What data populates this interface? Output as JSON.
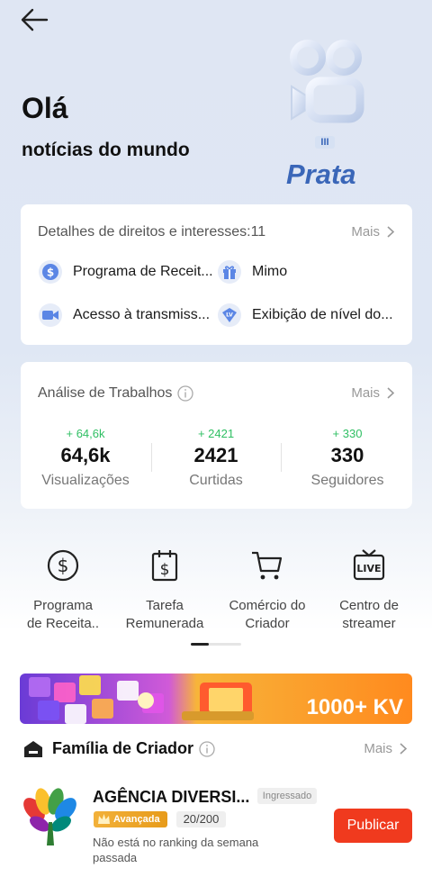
{
  "header": {
    "greeting": "Olá",
    "subtitle": "notícias do mundo",
    "badge_level": "Prata",
    "badge_numeral": "III"
  },
  "rights": {
    "title": "Detalhes de direitos e interesses:11",
    "more": "Mais",
    "items": [
      {
        "label": "Programa de Receit...",
        "icon": "dollar-icon"
      },
      {
        "label": "Mimo",
        "icon": "gift-icon"
      },
      {
        "label": "Acesso à transmiss...",
        "icon": "video-icon"
      },
      {
        "label": "Exibição de nível do...",
        "icon": "level-icon"
      }
    ]
  },
  "analysis": {
    "title": "Análise de Trabalhos",
    "more": "Mais",
    "stats": [
      {
        "delta": "+ 64,6k",
        "value": "64,6k",
        "label": "Visualizações"
      },
      {
        "delta": "+ 2421",
        "value": "2421",
        "label": "Curtidas"
      },
      {
        "delta": "+ 330",
        "value": "330",
        "label": "Seguidores"
      }
    ]
  },
  "tools": [
    {
      "line1": "Programa",
      "line2": "de Receita..",
      "icon": "dollar-circle-icon"
    },
    {
      "line1": "Tarefa",
      "line2": "Remunerada",
      "icon": "calendar-dollar-icon"
    },
    {
      "line1": "Comércio do",
      "line2": "Criador",
      "icon": "cart-icon"
    },
    {
      "line1": "Centro de",
      "line2": "streamer",
      "icon": "live-tv-icon"
    }
  ],
  "banner": {
    "text": "1000+ KV"
  },
  "family": {
    "title": "Família de Criador",
    "more": "Mais",
    "agency_name": "AGÊNCIA DIVERSI...",
    "status": "Ingressado",
    "level": "Avançada",
    "members": "20/200",
    "ranking": "Não está no ranking da semana passada",
    "publish": "Publicar"
  },
  "colors": {
    "accent": "#f03a1e",
    "positive": "#2fbf63",
    "badge": "#3a66b8"
  }
}
